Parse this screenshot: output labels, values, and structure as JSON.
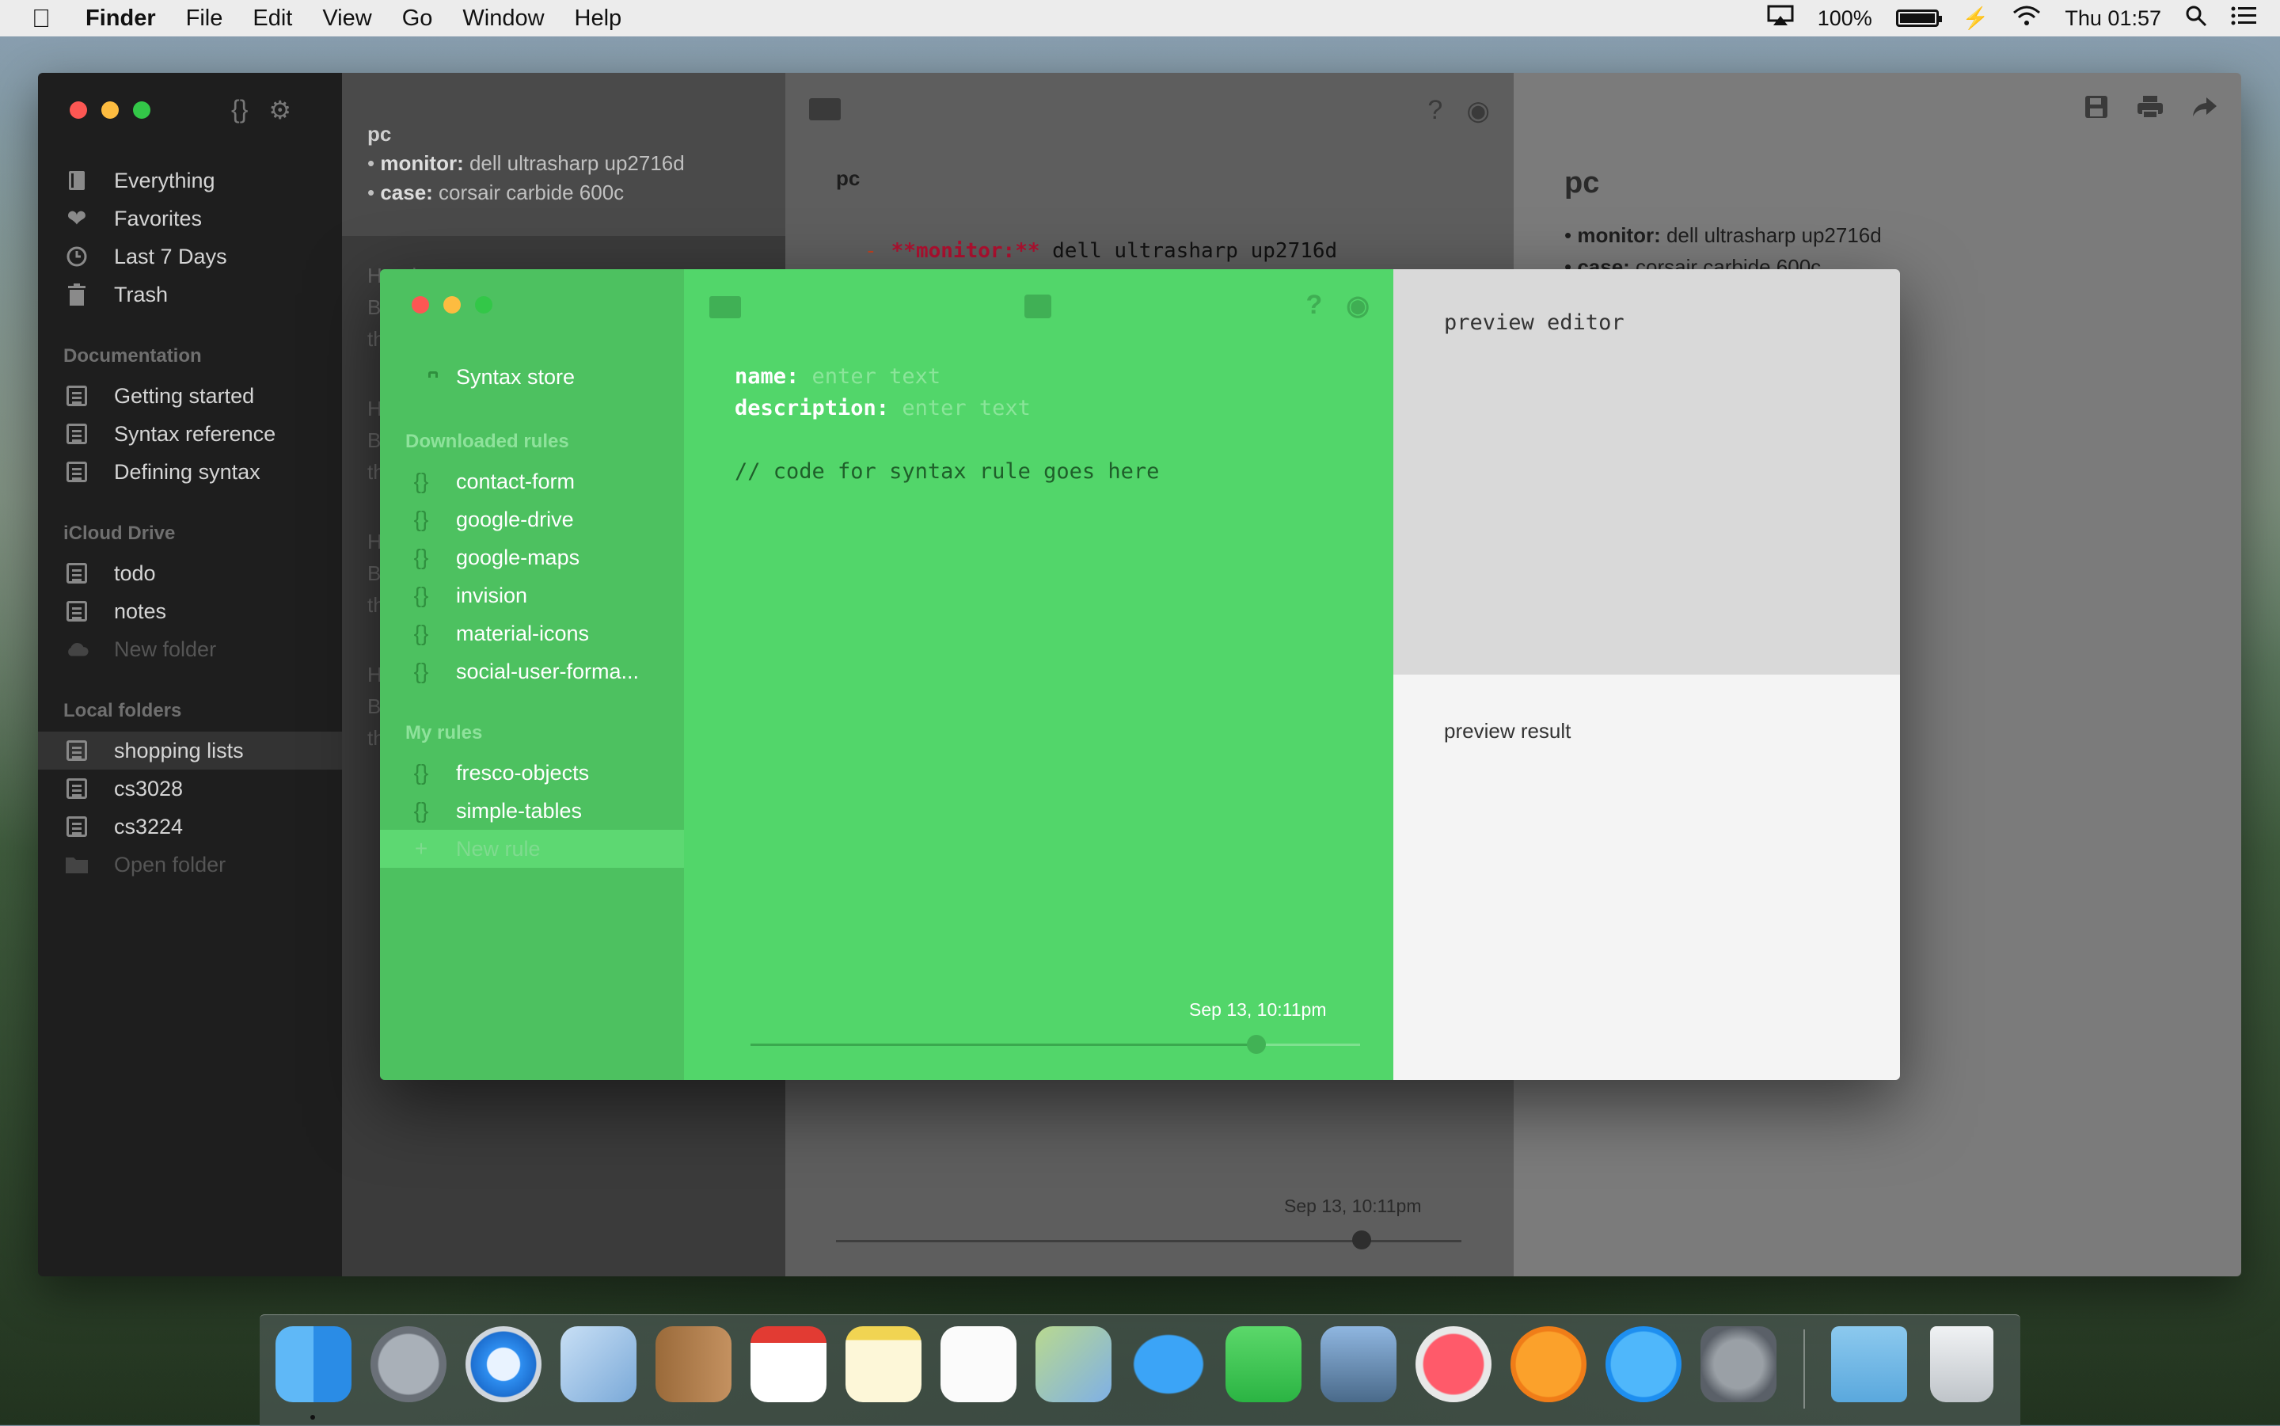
{
  "menubar": {
    "app_name": "Finder",
    "items": [
      "File",
      "Edit",
      "View",
      "Go",
      "Window",
      "Help"
    ],
    "battery_percent": "100%",
    "battery_level": 1.0,
    "clock": "Thu 01:57"
  },
  "back_sidebar": {
    "library": [
      {
        "label": "Everything",
        "icon": "book-icon"
      },
      {
        "label": "Favorites",
        "icon": "heart-icon"
      },
      {
        "label": "Last 7 Days",
        "icon": "clock-icon"
      },
      {
        "label": "Trash",
        "icon": "trash-icon"
      }
    ],
    "documentation_heading": "Documentation",
    "documentation": [
      "Getting started",
      "Syntax reference",
      "Defining syntax"
    ],
    "icloud_heading": "iCloud Drive",
    "icloud": [
      "todo",
      "notes"
    ],
    "icloud_new": "New folder",
    "local_heading": "Local folders",
    "local": [
      "shopping lists",
      "cs3028",
      "cs3224"
    ],
    "local_open": "Open folder"
  },
  "back_list": {
    "selected_title": "pc",
    "selected_lines": [
      {
        "key": "monitor:",
        "value": " dell ultrasharp up2716d"
      },
      {
        "key": "case:",
        "value": " corsair carbide 600c"
      }
    ],
    "stubs": [
      [
        "Header",
        "B",
        "th"
      ],
      [
        "H",
        "B",
        "th"
      ],
      [
        "H",
        "B",
        "th"
      ],
      [
        "H",
        "B",
        "th"
      ]
    ]
  },
  "back_editor": {
    "title": "pc",
    "code_dash": "-",
    "code_key": "**monitor:**",
    "code_value": " dell ultrasharp up2716d",
    "date": "Sep 13, 10:11pm",
    "slider_position": 0.84
  },
  "back_preview": {
    "title": "pc",
    "lines": [
      {
        "key": "monitor:",
        "value": " dell ultrasharp up2716d"
      },
      {
        "key": "case:",
        "value": " corsair carbide 600c"
      }
    ]
  },
  "dialog": {
    "store_label": "Syntax store",
    "downloaded_heading": "Downloaded rules",
    "downloaded": [
      "contact-form",
      "google-drive",
      "google-maps",
      "invision",
      "material-icons",
      "social-user-forma..."
    ],
    "my_rules_heading": "My rules",
    "my_rules": [
      "fresco-objects",
      "simple-tables"
    ],
    "new_rule": "New rule",
    "rule_icon": "{}",
    "add_icon": "+",
    "editor": {
      "name_label": "name:",
      "name_placeholder": "enter text",
      "description_label": "description:",
      "description_placeholder": "enter text",
      "code_comment": "// code for syntax rule goes here",
      "date": "Sep 13, 10:11pm",
      "slider_position": 0.83
    },
    "preview_editor_label": "preview editor",
    "preview_result_label": "preview result"
  },
  "colors": {
    "dialog_green": "#52d66a",
    "dialog_sidebar_green": "#4dc160",
    "dark_sidebar": "#1e1e1e"
  },
  "dock": {
    "apps": [
      "finder-icon",
      "launchpad-icon",
      "safari-icon",
      "mail-icon",
      "contacts-icon",
      "calendar-icon",
      "notes-icon",
      "reminders-icon",
      "maps-icon",
      "messages-icon",
      "facetime-icon",
      "photo-booth-icon",
      "itunes-icon",
      "ibooks-icon",
      "app-store-icon",
      "system-preferences-icon",
      "downloads-folder-icon",
      "trash-icon"
    ]
  }
}
